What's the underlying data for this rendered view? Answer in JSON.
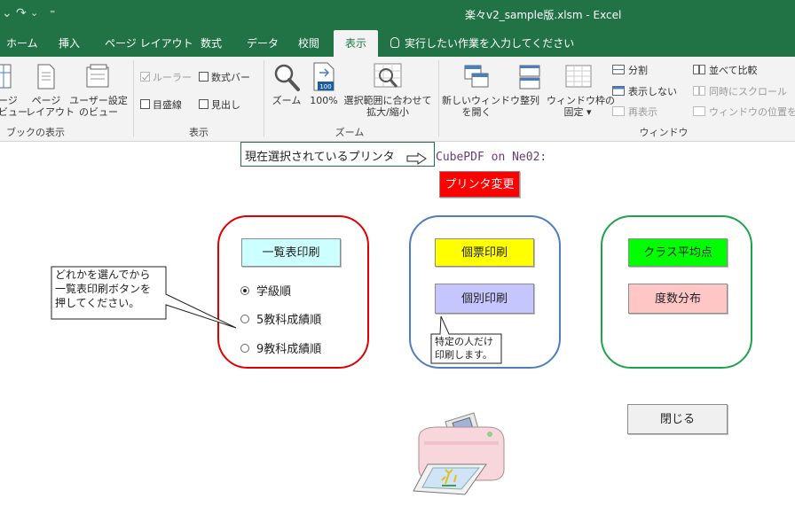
{
  "window": {
    "title": "楽々v2_sample版.xlsm  -  Excel",
    "undo_symbol": "⌄",
    "redo_symbol": "↷",
    "customize_symbol": "⁼"
  },
  "tabs": [
    {
      "label": "ホーム",
      "active": false
    },
    {
      "label": "挿入",
      "active": false
    },
    {
      "label": "ページ レイアウト",
      "active": false
    },
    {
      "label": "数式",
      "active": false
    },
    {
      "label": "データ",
      "active": false
    },
    {
      "label": "校閲",
      "active": false
    },
    {
      "label": "表示",
      "active": true
    }
  ],
  "tellme": "実行したい作業を入力してください",
  "ribbon": {
    "workbook_views": {
      "group_label": "ブックの表示",
      "page_break": [
        "ージ",
        "ビュー"
      ],
      "page_layout": [
        "ページ",
        "レイアウト"
      ],
      "custom_views": [
        "ユーザー設定",
        "のビュー"
      ]
    },
    "show": {
      "group_label": "表示",
      "ruler": "ルーラー",
      "formula_bar": "数式バー",
      "gridlines": "目盛線",
      "headings": "見出し"
    },
    "zoom": {
      "group_label": "ズーム",
      "zoom": "ズーム",
      "zoom_100": "100%",
      "zoom_100_icon_text": "100",
      "zoom_selection": [
        "選択範囲に合わせて",
        "拡大/縮小"
      ]
    },
    "window": {
      "group_label": "ウィンドウ",
      "new_window": [
        "新しいウィンドウ",
        "を開く"
      ],
      "arrange_all": "整列",
      "freeze_panes": [
        "ウィンドウ枠の",
        "固定 ▾"
      ],
      "split": "分割",
      "hide": "表示しない",
      "unhide": "再表示",
      "view_side_by_side": "並べて比較",
      "synchronous_scrolling": "同時にスクロール",
      "reset_window_position": "ウィンドウの位置を元"
    }
  },
  "sheet": {
    "printer_label": "現在選択されているプリンタ",
    "printer_name": "CubePDF on Ne02:",
    "change_printer_button": "プリンタ変更",
    "list_print_button": "一覧表印刷",
    "sort_options": [
      {
        "label": "学級順",
        "selected": true
      },
      {
        "label": "5教科成績順",
        "selected": false
      },
      {
        "label": "9教科成績順",
        "selected": false
      }
    ],
    "callout_list": [
      "どれかを選んでから",
      "一覧表印刷ボタンを",
      "押してください。"
    ],
    "slip_print_button": "個票印刷",
    "individual_print_button": "個別印刷",
    "callout_individual": [
      "特定の人だけ",
      "印刷します。"
    ],
    "class_average_button": "クラス平均点",
    "frequency_button": "度数分布",
    "close_button": "閉じる"
  },
  "colors": {
    "excel_green": "#217346",
    "ribbon_bg": "#f3f3f3",
    "change_printer": "#ff0000",
    "list_print": "#ccffff",
    "slip_print": "#ffff00",
    "individual_print": "#c6c6ff",
    "class_average": "#00ff00",
    "frequency": "#ffc6c6",
    "group_list_border": "#e00000",
    "group_individual_border": "#4f7ec0",
    "group_stats_border": "#1ea34a"
  }
}
